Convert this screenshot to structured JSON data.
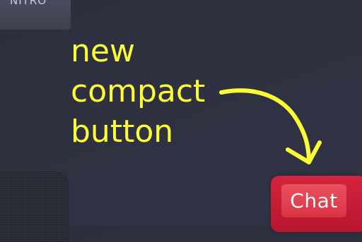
{
  "top_badge": {
    "label": "NITRO"
  },
  "annotation": {
    "lines": [
      "new",
      "compact",
      "button"
    ],
    "color": "#ffff33"
  },
  "chat_button": {
    "label": "Chat",
    "color": "#c81d37"
  }
}
